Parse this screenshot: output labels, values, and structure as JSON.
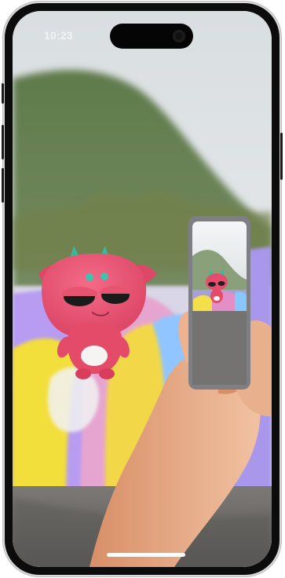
{
  "status_bar": {
    "time": "10:23"
  },
  "scene": {
    "icon": "ar-character-camera-scene"
  },
  "colors": {
    "sky": "#dfe5e9",
    "mountain": "#4f6b3c",
    "mural_violet": "#b79cf2",
    "mural_yellow": "#f3df3b",
    "character_pink": "#ea4b6d",
    "ear_teal": "#39b8a0",
    "skin": "#e8ad8a"
  }
}
